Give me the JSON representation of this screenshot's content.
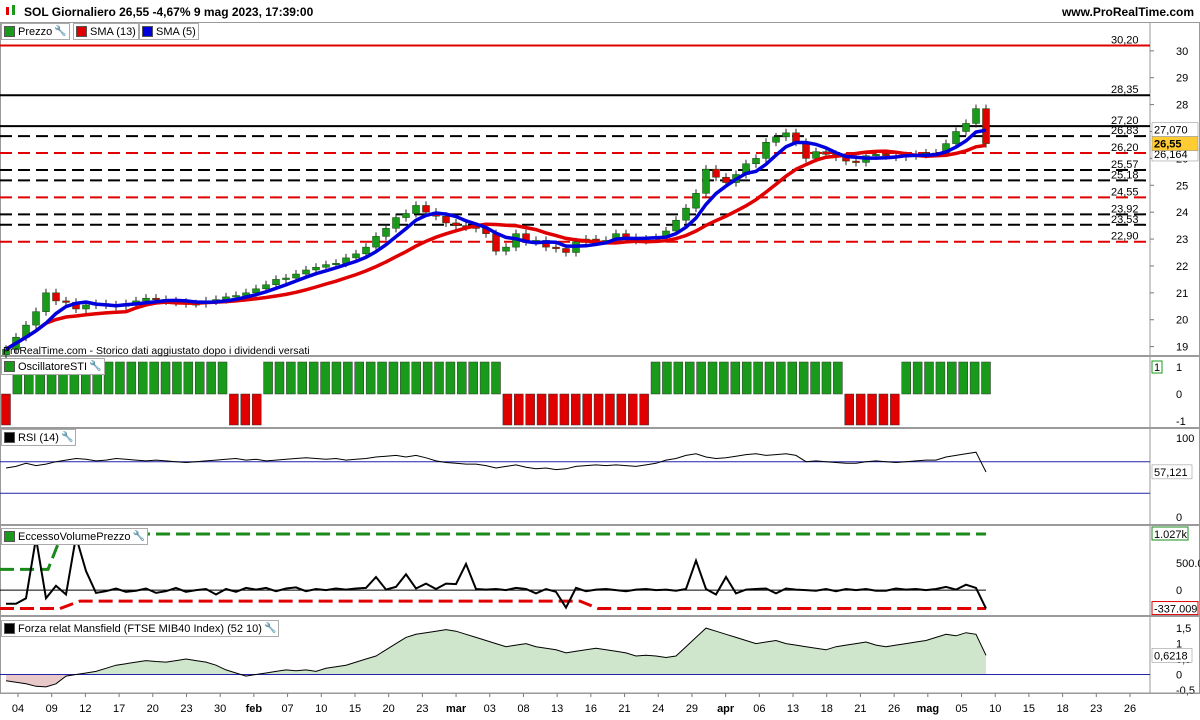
{
  "header": {
    "title": "SOL Giornaliero 26,55 -4,67% 9 mag 2023, 17:39:00",
    "site": "www.ProRealTime.com"
  },
  "legends": {
    "price": {
      "label": "Prezzo",
      "color": "#1a9a1a"
    },
    "sma13": {
      "label": "SMA (13)",
      "color": "#e00000"
    },
    "sma5": {
      "label": "SMA (5)",
      "color": "#0000dd"
    },
    "sti": {
      "label": "OscillatoreSTI"
    },
    "rsi": {
      "label": "RSI (14)"
    },
    "evp": {
      "label": "EccessoVolumePrezzo"
    },
    "mansfield": {
      "label": "Forza relat Mansfield (FTSE MIB40 Index) (52 10)"
    }
  },
  "note": "ProRealTime.com - Storico dati aggiustato dopo i dividendi versati",
  "chart_data": [
    {
      "type": "candlestick",
      "panel": "price",
      "ylim": [
        18.8,
        30.7
      ],
      "y_ticks": [
        "19",
        "20",
        "21",
        "22",
        "23",
        "24",
        "25",
        "26",
        "27",
        "28",
        "29",
        "30"
      ],
      "x_tick_labels": [
        "04",
        "09",
        "12",
        "17",
        "20",
        "23",
        "30",
        "feb",
        "07",
        "10",
        "15",
        "20",
        "23",
        "mar",
        "03",
        "08",
        "13",
        "16",
        "21",
        "24",
        "29",
        "apr",
        "06",
        "13",
        "18",
        "21",
        "26",
        "mag",
        "05",
        "10",
        "15",
        "18",
        "23",
        "26"
      ],
      "level_lines": [
        {
          "value": 30.2,
          "label": "30,20",
          "color": "#e00000",
          "style": "solid"
        },
        {
          "value": 28.35,
          "label": "28,35",
          "color": "#000000",
          "style": "solid"
        },
        {
          "value": 27.2,
          "label": "27,20",
          "color": "#000000",
          "style": "solid"
        },
        {
          "value": 26.83,
          "label": "26,83",
          "color": "#000000",
          "style": "dashed"
        },
        {
          "value": 26.2,
          "label": "26,20",
          "color": "#e00000",
          "style": "dashed"
        },
        {
          "value": 25.57,
          "label": "25,57",
          "color": "#000000",
          "style": "dashed"
        },
        {
          "value": 25.18,
          "label": "25,18",
          "color": "#000000",
          "style": "dashed"
        },
        {
          "value": 24.55,
          "label": "24,55",
          "color": "#e00000",
          "style": "dashed"
        },
        {
          "value": 23.92,
          "label": "23,92",
          "color": "#000000",
          "style": "dashed"
        },
        {
          "value": 23.53,
          "label": "23,53",
          "color": "#000000",
          "style": "dashed"
        },
        {
          "value": 22.9,
          "label": "22,90",
          "color": "#e00000",
          "style": "dashed"
        }
      ],
      "last_price": {
        "value": 26.55,
        "label": "26,55"
      },
      "sma5_last": {
        "value": 27.07,
        "label": "27,070"
      },
      "sma13_last": {
        "value": 26.164,
        "label": "26,164"
      },
      "close": [
        18.9,
        19.35,
        19.8,
        20.3,
        21.0,
        20.7,
        20.65,
        20.4,
        20.55,
        20.6,
        20.55,
        20.5,
        20.6,
        20.7,
        20.8,
        20.75,
        20.7,
        20.65,
        20.6,
        20.6,
        20.7,
        20.75,
        20.85,
        20.9,
        21.0,
        21.15,
        21.3,
        21.5,
        21.55,
        21.7,
        21.85,
        21.95,
        22.05,
        22.1,
        22.3,
        22.45,
        22.7,
        23.1,
        23.4,
        23.8,
        23.95,
        24.25,
        24.0,
        23.85,
        23.6,
        23.5,
        23.45,
        23.4,
        23.2,
        22.55,
        22.7,
        23.2,
        22.9,
        22.95,
        22.7,
        22.65,
        22.5,
        22.9,
        23.0,
        22.95,
        22.95,
        23.2,
        23.05,
        22.95,
        23.0,
        23.05,
        23.3,
        23.7,
        24.15,
        24.7,
        25.6,
        25.3,
        25.1,
        25.4,
        25.8,
        26.0,
        26.6,
        26.8,
        26.95,
        26.6,
        26.0,
        26.25,
        26.15,
        26.05,
        25.9,
        25.85,
        26.1,
        26.15,
        26.1,
        26.05,
        26.1,
        26.15,
        26.2,
        26.2,
        26.55,
        27.0,
        27.3,
        27.85,
        26.55
      ]
    },
    {
      "type": "bar",
      "panel": "OscillatoreSTI",
      "ylim": [
        -1,
        1
      ],
      "y_ticks": [
        "1",
        "0",
        "-1"
      ],
      "last_value_label": "1",
      "values": [
        -1,
        1,
        1,
        1,
        1,
        1,
        1,
        1,
        1,
        1,
        1,
        1,
        1,
        1,
        1,
        1,
        1,
        1,
        1,
        1,
        -1,
        -1,
        -1,
        1,
        1,
        1,
        1,
        1,
        1,
        1,
        1,
        1,
        1,
        1,
        1,
        1,
        1,
        1,
        1,
        1,
        1,
        1,
        1,
        1,
        -1,
        -1,
        -1,
        -1,
        -1,
        -1,
        -1,
        -1,
        -1,
        -1,
        -1,
        -1,
        -1,
        1,
        1,
        1,
        1,
        1,
        1,
        1,
        1,
        1,
        1,
        1,
        1,
        1,
        1,
        1,
        1,
        1,
        -1,
        -1,
        -1,
        -1,
        -1,
        1,
        1,
        1,
        1,
        1,
        1,
        1,
        1
      ]
    },
    {
      "type": "line",
      "panel": "RSI (14)",
      "ylim": [
        0,
        100
      ],
      "y_ticks": [
        "100",
        "0"
      ],
      "bands": [
        70,
        30
      ],
      "last_value": {
        "value": 57.121,
        "label": "57,121"
      },
      "values": [
        62,
        64,
        68,
        65,
        67,
        70,
        72,
        74,
        73,
        71,
        72,
        74,
        73,
        72,
        71,
        72,
        71,
        70,
        69,
        70,
        71,
        72,
        73,
        74,
        72,
        73,
        71,
        72,
        73,
        74,
        75,
        74,
        73,
        74,
        72,
        73,
        74,
        76,
        77,
        78,
        76,
        78,
        75,
        71,
        69,
        68,
        67,
        67,
        65,
        62,
        64,
        66,
        63,
        61,
        62,
        60,
        61,
        64,
        65,
        66,
        65,
        66,
        65,
        64,
        66,
        68,
        72,
        74,
        78,
        80,
        76,
        74,
        75,
        77,
        79,
        80,
        78,
        79,
        80,
        78,
        70,
        71,
        70,
        69,
        68,
        68,
        70,
        71,
        70,
        69,
        70,
        71,
        72,
        72,
        76,
        78,
        80,
        82,
        57
      ]
    },
    {
      "type": "line",
      "panel": "EccessoVolumePrezzo",
      "y_tick_labels": [
        "500.000",
        "0"
      ],
      "upper_band_label": "1.027k",
      "lower_band_label": "-337.009",
      "values": [
        -250000,
        -250000,
        -150000,
        950000,
        -150000,
        80000,
        -80000,
        980000,
        350000,
        -50000,
        -20000,
        30000,
        -30000,
        -10000,
        30000,
        -50000,
        -20000,
        40000,
        -30000,
        0,
        20000,
        -80000,
        20000,
        -30000,
        40000,
        10000,
        40000,
        -20000,
        30000,
        50000,
        -20000,
        20000,
        0,
        30000,
        10000,
        30000,
        40000,
        240000,
        10000,
        60000,
        290000,
        30000,
        120000,
        20000,
        120000,
        110000,
        480000,
        20000,
        10000,
        20000,
        0,
        40000,
        20000,
        -60000,
        20000,
        -30000,
        -320000,
        40000,
        -20000,
        10000,
        20000,
        0,
        -20000,
        10000,
        20000,
        0,
        10000,
        -10000,
        20000,
        540000,
        20000,
        -80000,
        240000,
        -60000,
        10000,
        20000,
        30000,
        -60000,
        30000,
        10000,
        0,
        -10000,
        20000,
        -20000,
        20000,
        0,
        20000,
        -10000,
        -10000,
        30000,
        10000,
        20000,
        0,
        20000,
        60000,
        10000,
        100000,
        40000,
        -337009
      ]
    },
    {
      "type": "area",
      "panel": "Mansfield",
      "ylim": [
        -0.5,
        1.6
      ],
      "y_ticks": [
        "1,5",
        "1",
        "0,5",
        "0",
        "-0,5"
      ],
      "last_value": {
        "value": 0.6218,
        "label": "0,6218"
      },
      "values": [
        -0.2,
        -0.25,
        -0.3,
        -0.38,
        -0.4,
        -0.3,
        -0.05,
        0.0,
        0.05,
        0.1,
        0.2,
        0.3,
        0.35,
        0.4,
        0.45,
        0.42,
        0.4,
        0.45,
        0.5,
        0.45,
        0.4,
        0.3,
        0.15,
        0.05,
        -0.05,
        0.0,
        0.05,
        0.1,
        0.15,
        0.12,
        0.15,
        0.1,
        0.2,
        0.25,
        0.3,
        0.4,
        0.5,
        0.6,
        0.8,
        1.0,
        1.2,
        1.3,
        1.35,
        1.4,
        1.45,
        1.4,
        1.3,
        1.2,
        1.1,
        1.0,
        0.9,
        0.95,
        1.0,
        0.9,
        0.85,
        0.8,
        0.7,
        0.75,
        0.8,
        0.85,
        0.8,
        0.75,
        0.7,
        0.6,
        0.62,
        0.6,
        0.55,
        0.6,
        0.9,
        1.2,
        1.5,
        1.4,
        1.3,
        1.2,
        1.1,
        1.0,
        1.05,
        1.1,
        1.0,
        0.95,
        0.9,
        0.85,
        0.8,
        0.9,
        0.95,
        1.0,
        1.05,
        0.95,
        0.9,
        0.95,
        1.0,
        1.05,
        1.1,
        1.2,
        1.3,
        1.25,
        1.35,
        1.3,
        0.6218
      ]
    }
  ]
}
